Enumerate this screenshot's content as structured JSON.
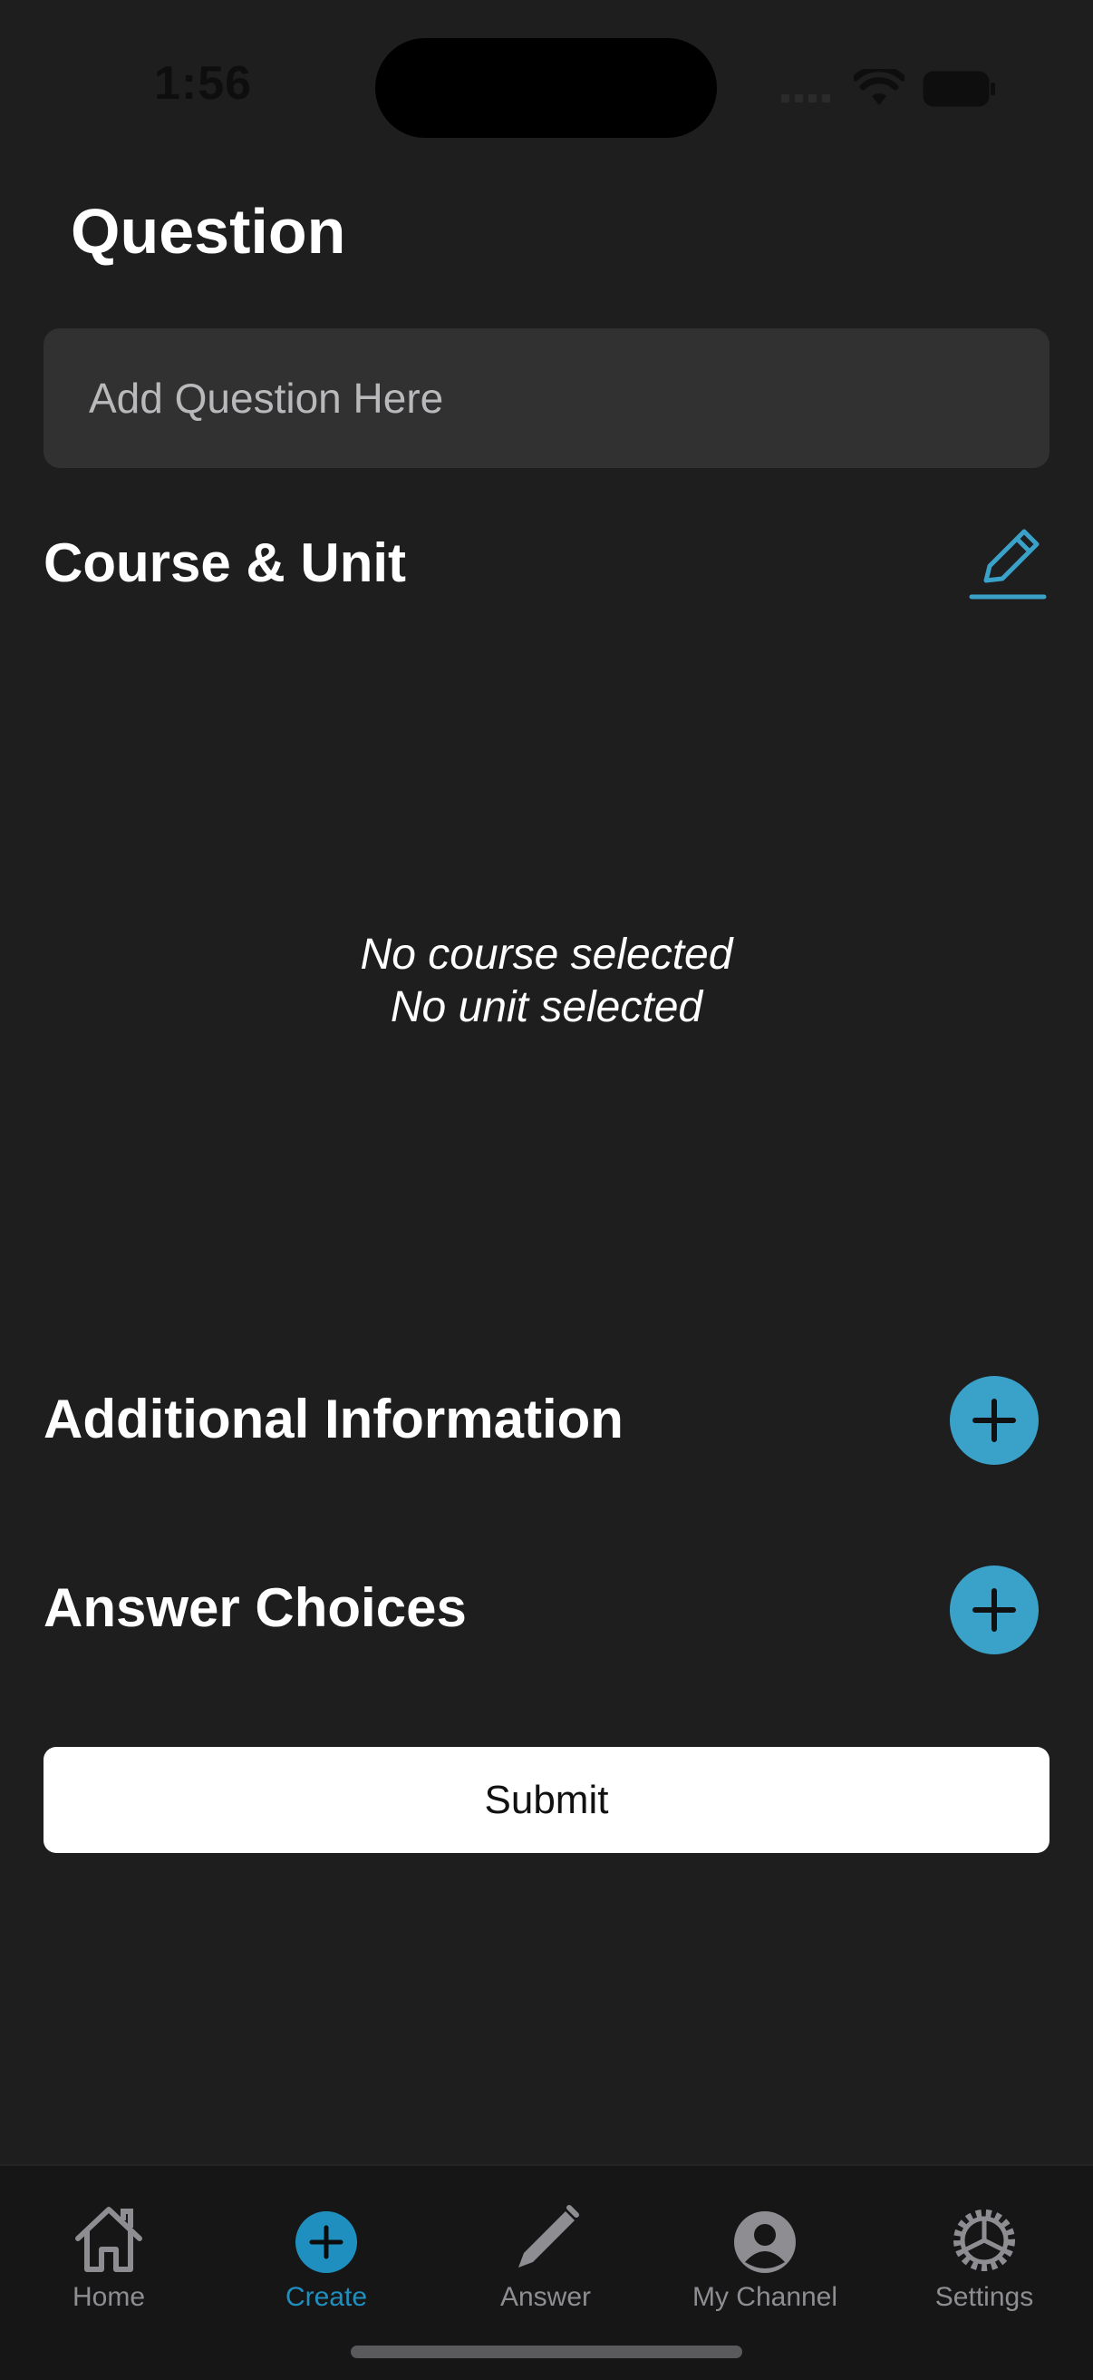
{
  "status_bar": {
    "time": "1:56"
  },
  "page_title": "Question",
  "question_input": {
    "placeholder": "Add Question Here",
    "value": ""
  },
  "course_section": {
    "heading": "Course & Unit",
    "empty_course": "No course selected",
    "empty_unit": "No unit selected"
  },
  "additional_info": {
    "heading": "Additional Information"
  },
  "answer_choices": {
    "heading": "Answer Choices"
  },
  "submit_label": "Submit",
  "tabs": [
    {
      "label": "Home",
      "icon": "home-icon"
    },
    {
      "label": "Create",
      "icon": "plus-circle-icon",
      "active": true
    },
    {
      "label": "Answer",
      "icon": "pencil-icon"
    },
    {
      "label": "My Channel",
      "icon": "person-circle-icon"
    },
    {
      "label": "Settings",
      "icon": "gear-icon"
    }
  ],
  "colors": {
    "accent": "#3aa1c9",
    "active_tab": "#1e8fbf",
    "background": "#1e1e1f",
    "input_bg": "#313132"
  }
}
